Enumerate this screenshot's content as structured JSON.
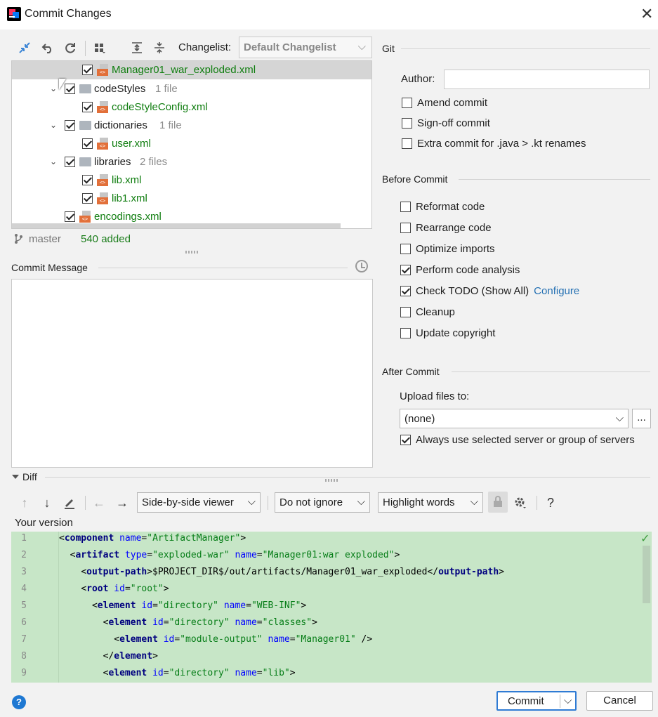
{
  "window": {
    "title": "Commit Changes",
    "close": "✕"
  },
  "toolbar": {
    "changelist_label": "Changelist:",
    "changelist_value": "Default Changelist"
  },
  "tree": {
    "rows": [
      {
        "name": "Manager01_war_exploded.xml",
        "count": ""
      },
      {
        "name": "codeStyles",
        "count": "1 file"
      },
      {
        "name": "codeStyleConfig.xml",
        "count": ""
      },
      {
        "name": "dictionaries",
        "count": "1 file"
      },
      {
        "name": "user.xml",
        "count": ""
      },
      {
        "name": "libraries",
        "count": "2 files"
      },
      {
        "name": "lib.xml",
        "count": ""
      },
      {
        "name": "lib1.xml",
        "count": ""
      },
      {
        "name": "encodings.xml",
        "count": ""
      }
    ]
  },
  "status": {
    "branch": "master",
    "added": "540 added"
  },
  "commit_message": {
    "label": "Commit Message",
    "value": ""
  },
  "git": {
    "title": "Git",
    "author_label": "Author:",
    "author_value": "",
    "amend": "Amend commit",
    "signoff": "Sign-off commit",
    "extra": "Extra commit for .java > .kt renames"
  },
  "before_commit": {
    "title": "Before Commit",
    "reformat": "Reformat code",
    "rearrange": "Rearrange code",
    "optimize": "Optimize imports",
    "analysis": "Perform code analysis",
    "todo": "Check TODO (Show All)",
    "configure": "Configure",
    "cleanup": "Cleanup",
    "copyright": "Update copyright"
  },
  "after_commit": {
    "title": "After Commit",
    "upload_label": "Upload files to:",
    "upload_value": "(none)",
    "more": "...",
    "always": "Always use selected server or group of servers"
  },
  "diff": {
    "label": "Diff",
    "viewer": "Side-by-side viewer",
    "ignore": "Do not ignore",
    "highlight": "Highlight words",
    "help": "?",
    "your_version": "Your version",
    "lines": [
      "1",
      "2",
      "3",
      "4",
      "5",
      "6",
      "7",
      "8",
      "9"
    ]
  },
  "footer": {
    "help": "?",
    "commit": "Commit",
    "cancel": "Cancel"
  }
}
